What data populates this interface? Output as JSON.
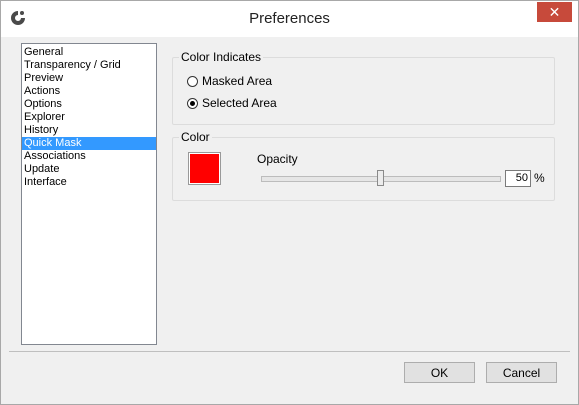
{
  "window": {
    "title": "Preferences",
    "close_glyph": "✕",
    "app_icon": "gear-swirl-icon"
  },
  "sidebar": {
    "items": [
      {
        "label": "General"
      },
      {
        "label": "Transparency / Grid"
      },
      {
        "label": "Preview"
      },
      {
        "label": "Actions"
      },
      {
        "label": "Options"
      },
      {
        "label": "Explorer"
      },
      {
        "label": "History"
      },
      {
        "label": "Quick Mask",
        "selected": true
      },
      {
        "label": "Associations"
      },
      {
        "label": "Update"
      },
      {
        "label": "Interface"
      }
    ]
  },
  "color_indicates": {
    "label": "Color Indicates",
    "options": [
      {
        "label": "Masked Area",
        "checked": false
      },
      {
        "label": "Selected Area",
        "checked": true
      }
    ]
  },
  "color_group": {
    "label": "Color",
    "swatch_color": "#ff0000",
    "opacity_label": "Opacity",
    "opacity_value": "50",
    "opacity_slider_fraction": 0.5,
    "percent_sign": "%"
  },
  "buttons": {
    "ok": "OK",
    "cancel": "Cancel"
  }
}
